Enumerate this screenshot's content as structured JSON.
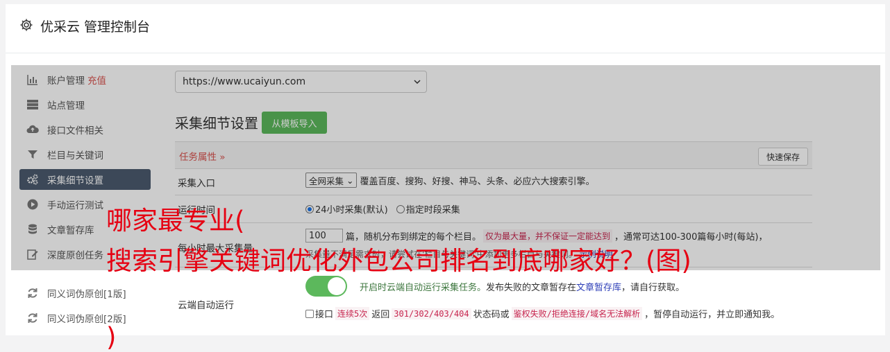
{
  "header": {
    "title": "优采云 管理控制台",
    "icon": "gear-icon"
  },
  "sidebar": {
    "items": [
      {
        "label": "账户管理",
        "extra": "充值",
        "icon": "bar-chart-icon"
      },
      {
        "label": "站点管理",
        "icon": "server-icon"
      },
      {
        "label": "接口文件相关",
        "icon": "cloud-upload-icon"
      },
      {
        "label": "栏目与关键词",
        "icon": "filter-icon"
      },
      {
        "label": "采集细节设置",
        "icon": "gears-icon",
        "active": true
      },
      {
        "label": "手动运行测试",
        "icon": "play-icon"
      },
      {
        "label": "文章暂存库",
        "icon": "database-icon"
      },
      {
        "label": "深度原创任务",
        "icon": "edit-icon"
      },
      {
        "label": "同义词伪原创[1版]",
        "icon": "refresh-icon"
      },
      {
        "label": "同义词伪原创[2版]",
        "icon": "refresh-icon"
      }
    ]
  },
  "site_select": {
    "value": "https://www.ucaiyun.com"
  },
  "section": {
    "title": "采集细节设置",
    "import_button": "从模板导入"
  },
  "table": {
    "header_label": "任务属性",
    "quick_save": "快速保存",
    "rows": {
      "entry": {
        "label": "采集入口",
        "select": "全网采集",
        "desc": "覆盖百度、搜狗、好搜、神马、头条、必应六大搜索引擎。"
      },
      "time": {
        "label": "运行时间",
        "opt1": "24小时采集(默认)",
        "opt2": "指定时段采集"
      },
      "max": {
        "label": "每小时最大采集量",
        "value": "100",
        "desc1": "篇，随机分布到绑定的每个栏目。",
        "warn": "仅为最大量，并不保证一定能达到",
        "desc2": "，通常可达100-300篇每小时(每站)，",
        "line2": "采集量不满足需求时，请尝试在'栏目与关键词'中添加更多栏目与关键词。",
        "line2_link": "示例说明"
      },
      "cloud": {
        "label": "云端自动运行",
        "desc_green": "开启时云端自动运行采集任务。",
        "desc_mid": "发布失败的文章暂存在",
        "desc_link": "文章暂存库",
        "desc_end": "，请自行获取。",
        "chk_label": "接口",
        "code1": "连续5次",
        "txt1": "返回",
        "code2": "301/302/403/404",
        "txt2": "状态码或",
        "code3": "鉴权失败/拒绝连接/域名无法解析",
        "txt3": "，暂停自动运行，并立即通知我。"
      }
    }
  },
  "watermark": {
    "line1": "哪家最专业(",
    "line2": "搜索引擎关键词优化外包公司排名到底哪家好？(图)",
    "line3": ")"
  }
}
